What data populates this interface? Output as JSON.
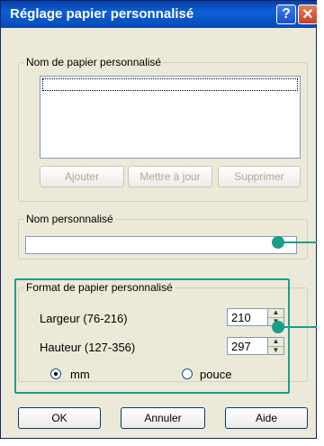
{
  "window": {
    "title": "Réglage papier personnalisé",
    "help_glyph": "?",
    "close_glyph": "✕"
  },
  "custom_paper_group": {
    "legend": "Nom de papier personnalisé",
    "list_items": [],
    "buttons": {
      "add": "Ajouter",
      "update": "Mettre à jour",
      "delete": "Supprimer"
    }
  },
  "custom_name_group": {
    "legend": "Nom personnalisé",
    "value": ""
  },
  "format_group": {
    "legend": "Format de papier personnalisé",
    "width_label": "Largeur (76-216)",
    "width_value": "210",
    "height_label": "Hauteur (127-356)",
    "height_value": "297",
    "unit_mm": "mm",
    "unit_pouce": "pouce",
    "selected_unit": "mm"
  },
  "footer": {
    "ok": "OK",
    "cancel": "Annuler",
    "help": "Aide"
  },
  "colors": {
    "titlebar": "#0b5fd8",
    "callout": "#1a9e8c",
    "dialog_bg": "#ece9d8"
  }
}
